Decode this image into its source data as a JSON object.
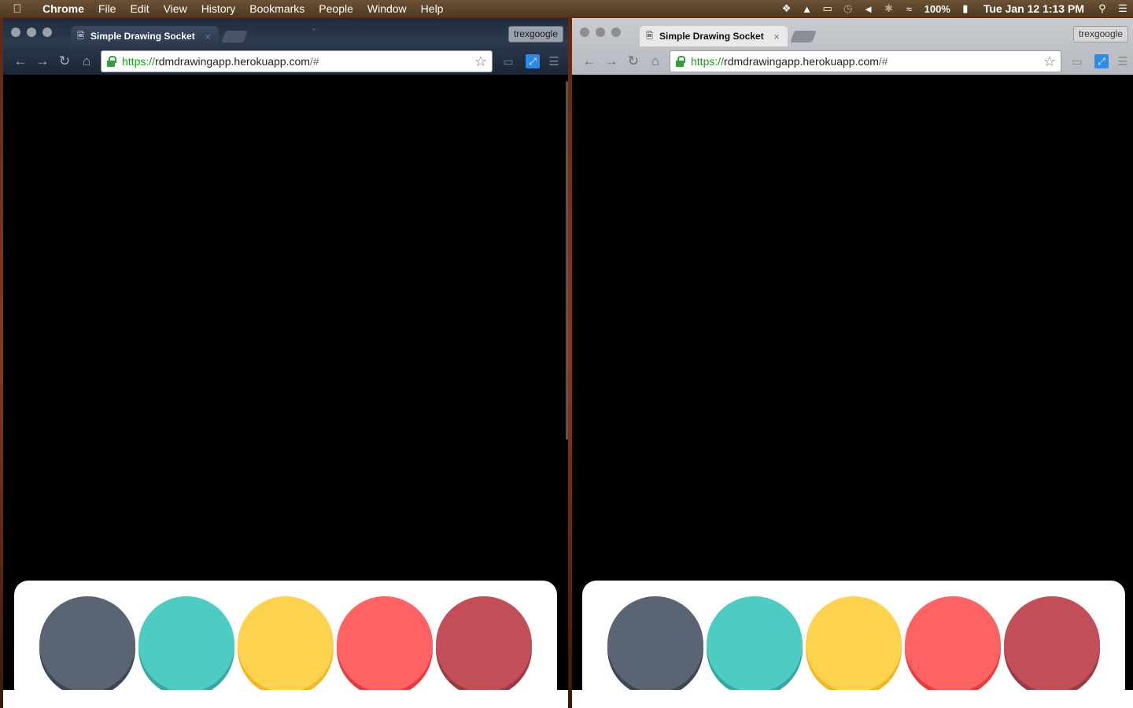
{
  "menubar": {
    "app_name": "Chrome",
    "items": [
      "File",
      "Edit",
      "View",
      "History",
      "Bookmarks",
      "People",
      "Window",
      "Help"
    ],
    "battery": "100%",
    "clock": "Tue Jan 12  1:13 PM"
  },
  "windows": [
    {
      "tab_title": "Simple Drawing Socket",
      "profile": "trexgoogle",
      "url": {
        "scheme": "https://",
        "host": "rdmdrawingapp.herokuapp.com",
        "rest": "/#"
      }
    },
    {
      "tab_title": "Simple Drawing Socket",
      "profile": "trexgoogle",
      "url": {
        "scheme": "https://",
        "host": "rdmdrawingapp.herokuapp.com",
        "rest": "/#"
      }
    }
  ],
  "palette": [
    {
      "name": "slate",
      "fill": "#5a6473",
      "shade": "#3e4652"
    },
    {
      "name": "teal",
      "fill": "#4ecbc2",
      "shade": "#37a89f"
    },
    {
      "name": "yellow",
      "fill": "#fdd24e",
      "shade": "#f2b821"
    },
    {
      "name": "coral",
      "fill": "#ff6262",
      "shade": "#e83c3c"
    },
    {
      "name": "crimson",
      "fill": "#c24e57",
      "shade": "#9a3a42"
    }
  ]
}
